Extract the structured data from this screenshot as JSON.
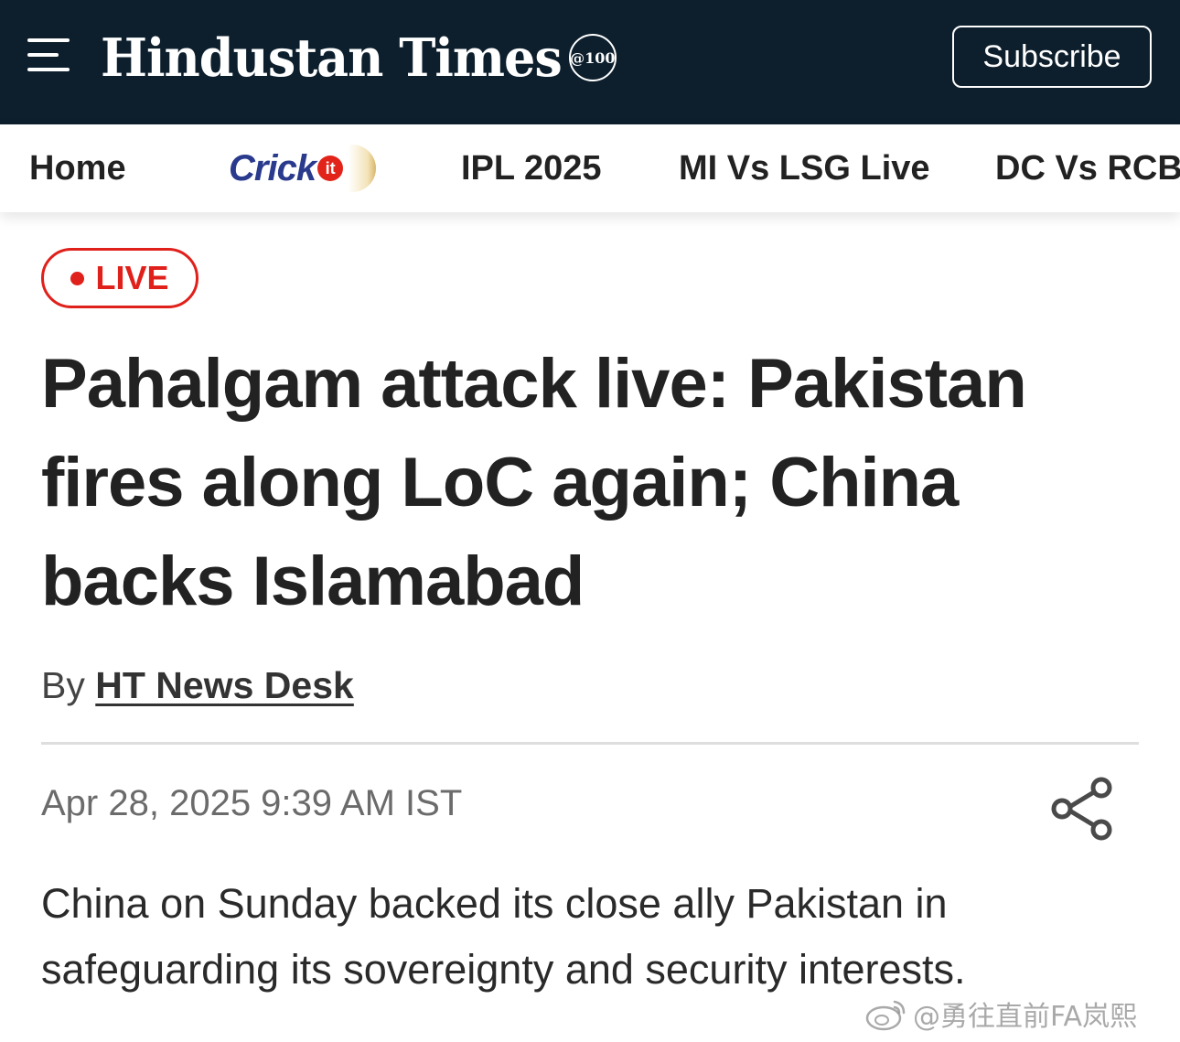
{
  "header": {
    "logo_text": "Hindustan Times",
    "logo_badge": "@100",
    "subscribe_label": "Subscribe",
    "background_color": "#0d1f2d"
  },
  "nav": {
    "items": [
      {
        "label": "Home"
      },
      {
        "label": "Crickit",
        "logo_text": "Crick",
        "logo_badge": "it"
      },
      {
        "label": "IPL 2025"
      },
      {
        "label": "MI Vs LSG Live"
      },
      {
        "label": "DC Vs RCB"
      }
    ]
  },
  "article": {
    "live_label": "LIVE",
    "live_color": "#e0201b",
    "headline": "Pahalgam attack live: Pakistan fires along LoC again; China backs Islamabad",
    "byline_prefix": "By",
    "author": "HT News Desk",
    "timestamp": "Apr 28, 2025 9:39 AM IST",
    "summary": "China on Sunday backed its close ally Pakistan in safeguarding its sovereignty and security interests.",
    "share_icon": "share-icon"
  },
  "watermark": {
    "text": "@勇往直前FA岚熙",
    "icon": "weibo-icon"
  }
}
